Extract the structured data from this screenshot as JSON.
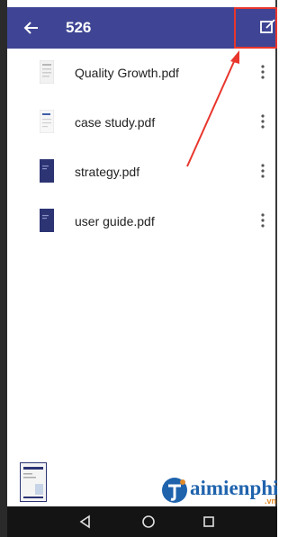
{
  "header": {
    "title": "526",
    "back_icon": "arrow-left-icon",
    "edit_icon": "edit-icon",
    "background": "#3f4594"
  },
  "files": [
    {
      "name": "Quality Growth.pdf",
      "thumb": "doc-thumb-light"
    },
    {
      "name": "case study.pdf",
      "thumb": "doc-thumb-light"
    },
    {
      "name": "strategy.pdf",
      "thumb": "doc-thumb-dark"
    },
    {
      "name": "user guide.pdf",
      "thumb": "doc-thumb-dark"
    }
  ],
  "annotation": {
    "color": "#e8362d"
  },
  "watermark": {
    "text": "aimienphi",
    "sub": ".vn"
  },
  "nav": {
    "back": "triangle-back-icon",
    "home": "circle-home-icon",
    "recents": "square-recents-icon"
  }
}
